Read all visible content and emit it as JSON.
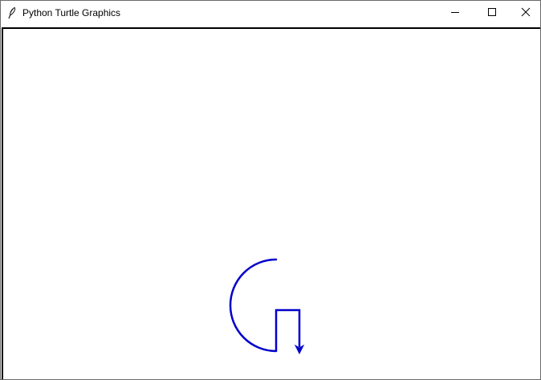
{
  "window": {
    "title": "Python Turtle Graphics",
    "app_icon": "feather-icon",
    "controls": {
      "minimize_icon": "minimize-icon",
      "maximize_icon": "maximize-icon",
      "close_icon": "close-icon"
    }
  },
  "turtle": {
    "pen_color": "#0000cc",
    "cursor_shape": "classic-arrow",
    "heading": "down"
  },
  "colors": {
    "titlebar_bg": "#ffffff",
    "canvas_bg": "#ffffff",
    "canvas_border": "#000000"
  }
}
